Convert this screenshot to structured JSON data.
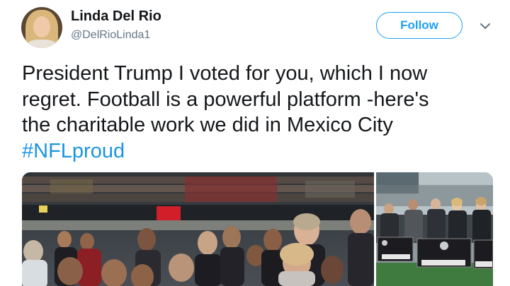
{
  "tweet": {
    "author_name": "Linda Del Rio",
    "author_handle": "@DelRioLinda1",
    "follow_label": "Follow",
    "text_lines": [
      "President Trump I voted for you, which I now",
      "regret. Football is a powerful platform -here's",
      "the charitable work we did in Mexico City"
    ],
    "hashtag": "#NFLproud"
  },
  "icons": {
    "menu": "chevron-down-icon"
  },
  "media": {
    "left_signs": [
      "Chiavasco"
    ],
    "right_signs": [
      "SPAGS IIIOO",
      "SPAGS IIIOO"
    ]
  },
  "colors": {
    "accent": "#1da1f2",
    "hashtag": "#1b95e0",
    "text": "#14171a",
    "secondary": "#657786"
  }
}
